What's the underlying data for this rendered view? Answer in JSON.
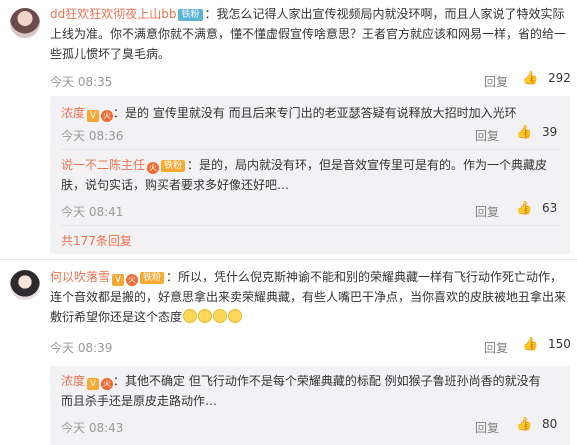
{
  "comments": [
    {
      "user": "dd狂欢狂欢彻夜上山bb",
      "badge": "铁粉",
      "lines": [
        "：我怎么记得人家出宣传视频局内就没环啊，而且人家说了特效实际",
        "上线为准。你不满意你就不满意，懂不懂虚假宣传啥意思？王者官方就应该和网易一样，省的给一",
        "些孤儿惯坏了臭毛病。"
      ],
      "time": "今天 08:35",
      "reply_label": "回复",
      "likes": "292",
      "replies": [
        {
          "user": "浓度",
          "lines": [
            "：是的 宣传里就没有 而且后来专门出的老亚瑟答疑有说释放大招时加入光环"
          ],
          "time": "今天 08:36",
          "reply_label": "回复",
          "likes": "39"
        },
        {
          "user": "说一不二陈主任",
          "badge": "铁粉",
          "lines": [
            "：是的，局内就没有环，但是音效宣传里可是有的。作为一个典藏皮",
            "肤，说句实话，购买者要求多好像还好吧…"
          ],
          "time": "今天 08:41",
          "reply_label": "回复",
          "likes": "63"
        }
      ],
      "more_replies": "共177条回复"
    },
    {
      "user": "何以吹落雪",
      "badge": "铁粉",
      "lines": [
        "：所以，凭什么倪克斯神谕不能和别的荣耀典藏一样有飞行动作死亡动作，",
        "连个音效都是搬的，好意思拿出来卖荣耀典藏，有些人嘴巴干净点，当你喜欢的皮肤被地丑拿出来",
        "敷衍希望你还是这个态度"
      ],
      "time": "今天 08:39",
      "reply_label": "回复",
      "likes": "150",
      "replies": [
        {
          "user": "浓度",
          "lines": [
            "：其他不确定 但飞行动作不是每个荣耀典藏的标配 例如猴子鲁班孙尚香的就没有",
            "而且杀手还是原皮走路动作…"
          ],
          "time": "今天 08:43",
          "reply_label": "回复",
          "likes": "80"
        }
      ]
    }
  ]
}
